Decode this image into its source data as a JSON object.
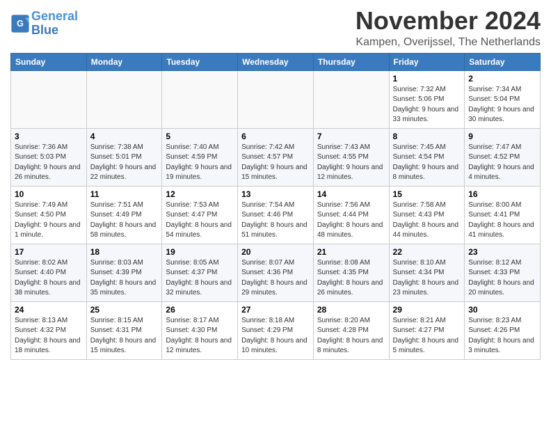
{
  "logo": {
    "line1": "General",
    "line2": "Blue"
  },
  "title": "November 2024",
  "location": "Kampen, Overijssel, The Netherlands",
  "weekdays": [
    "Sunday",
    "Monday",
    "Tuesday",
    "Wednesday",
    "Thursday",
    "Friday",
    "Saturday"
  ],
  "weeks": [
    [
      {
        "day": "",
        "detail": ""
      },
      {
        "day": "",
        "detail": ""
      },
      {
        "day": "",
        "detail": ""
      },
      {
        "day": "",
        "detail": ""
      },
      {
        "day": "",
        "detail": ""
      },
      {
        "day": "1",
        "detail": "Sunrise: 7:32 AM\nSunset: 5:06 PM\nDaylight: 9 hours and 33 minutes."
      },
      {
        "day": "2",
        "detail": "Sunrise: 7:34 AM\nSunset: 5:04 PM\nDaylight: 9 hours and 30 minutes."
      }
    ],
    [
      {
        "day": "3",
        "detail": "Sunrise: 7:36 AM\nSunset: 5:03 PM\nDaylight: 9 hours and 26 minutes."
      },
      {
        "day": "4",
        "detail": "Sunrise: 7:38 AM\nSunset: 5:01 PM\nDaylight: 9 hours and 22 minutes."
      },
      {
        "day": "5",
        "detail": "Sunrise: 7:40 AM\nSunset: 4:59 PM\nDaylight: 9 hours and 19 minutes."
      },
      {
        "day": "6",
        "detail": "Sunrise: 7:42 AM\nSunset: 4:57 PM\nDaylight: 9 hours and 15 minutes."
      },
      {
        "day": "7",
        "detail": "Sunrise: 7:43 AM\nSunset: 4:55 PM\nDaylight: 9 hours and 12 minutes."
      },
      {
        "day": "8",
        "detail": "Sunrise: 7:45 AM\nSunset: 4:54 PM\nDaylight: 9 hours and 8 minutes."
      },
      {
        "day": "9",
        "detail": "Sunrise: 7:47 AM\nSunset: 4:52 PM\nDaylight: 9 hours and 4 minutes."
      }
    ],
    [
      {
        "day": "10",
        "detail": "Sunrise: 7:49 AM\nSunset: 4:50 PM\nDaylight: 9 hours and 1 minute."
      },
      {
        "day": "11",
        "detail": "Sunrise: 7:51 AM\nSunset: 4:49 PM\nDaylight: 8 hours and 58 minutes."
      },
      {
        "day": "12",
        "detail": "Sunrise: 7:53 AM\nSunset: 4:47 PM\nDaylight: 8 hours and 54 minutes."
      },
      {
        "day": "13",
        "detail": "Sunrise: 7:54 AM\nSunset: 4:46 PM\nDaylight: 8 hours and 51 minutes."
      },
      {
        "day": "14",
        "detail": "Sunrise: 7:56 AM\nSunset: 4:44 PM\nDaylight: 8 hours and 48 minutes."
      },
      {
        "day": "15",
        "detail": "Sunrise: 7:58 AM\nSunset: 4:43 PM\nDaylight: 8 hours and 44 minutes."
      },
      {
        "day": "16",
        "detail": "Sunrise: 8:00 AM\nSunset: 4:41 PM\nDaylight: 8 hours and 41 minutes."
      }
    ],
    [
      {
        "day": "17",
        "detail": "Sunrise: 8:02 AM\nSunset: 4:40 PM\nDaylight: 8 hours and 38 minutes."
      },
      {
        "day": "18",
        "detail": "Sunrise: 8:03 AM\nSunset: 4:39 PM\nDaylight: 8 hours and 35 minutes."
      },
      {
        "day": "19",
        "detail": "Sunrise: 8:05 AM\nSunset: 4:37 PM\nDaylight: 8 hours and 32 minutes."
      },
      {
        "day": "20",
        "detail": "Sunrise: 8:07 AM\nSunset: 4:36 PM\nDaylight: 8 hours and 29 minutes."
      },
      {
        "day": "21",
        "detail": "Sunrise: 8:08 AM\nSunset: 4:35 PM\nDaylight: 8 hours and 26 minutes."
      },
      {
        "day": "22",
        "detail": "Sunrise: 8:10 AM\nSunset: 4:34 PM\nDaylight: 8 hours and 23 minutes."
      },
      {
        "day": "23",
        "detail": "Sunrise: 8:12 AM\nSunset: 4:33 PM\nDaylight: 8 hours and 20 minutes."
      }
    ],
    [
      {
        "day": "24",
        "detail": "Sunrise: 8:13 AM\nSunset: 4:32 PM\nDaylight: 8 hours and 18 minutes."
      },
      {
        "day": "25",
        "detail": "Sunrise: 8:15 AM\nSunset: 4:31 PM\nDaylight: 8 hours and 15 minutes."
      },
      {
        "day": "26",
        "detail": "Sunrise: 8:17 AM\nSunset: 4:30 PM\nDaylight: 8 hours and 12 minutes."
      },
      {
        "day": "27",
        "detail": "Sunrise: 8:18 AM\nSunset: 4:29 PM\nDaylight: 8 hours and 10 minutes."
      },
      {
        "day": "28",
        "detail": "Sunrise: 8:20 AM\nSunset: 4:28 PM\nDaylight: 8 hours and 8 minutes."
      },
      {
        "day": "29",
        "detail": "Sunrise: 8:21 AM\nSunset: 4:27 PM\nDaylight: 8 hours and 5 minutes."
      },
      {
        "day": "30",
        "detail": "Sunrise: 8:23 AM\nSunset: 4:26 PM\nDaylight: 8 hours and 3 minutes."
      }
    ]
  ]
}
